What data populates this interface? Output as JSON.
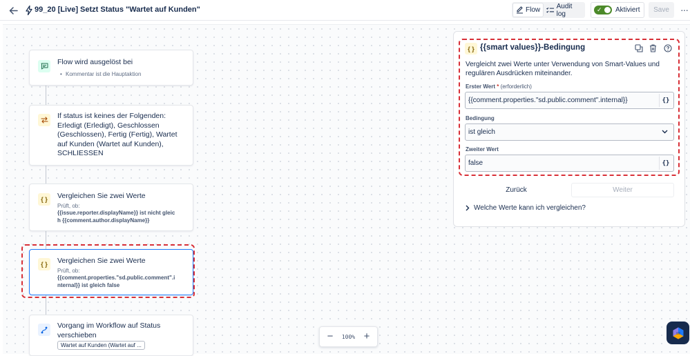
{
  "header": {
    "title": "99_20 [Live] Setzt Status \"Wartet auf Kunden\"",
    "flow_label": "Flow",
    "audit_label": "Audit log",
    "toggle_label": "Aktiviert",
    "toggle_on": true,
    "save_label": "Save",
    "more_label": "···"
  },
  "flow": {
    "trigger": {
      "title": "Flow wird ausgelöst bei",
      "detail": "Kommentar ist die Hauptaktion",
      "icon": "comment-icon"
    },
    "condition": {
      "title": "If status ist keines der Folgenden: Erledigt (Erledigt), Geschlossen (Geschlossen), Fertig (Fertig), Wartet auf Kunden (Wartet auf Kunden), SCHLIESSEN",
      "icon": "branch-arrows-icon"
    },
    "compare1": {
      "title": "Vergleichen Sie zwei Werte",
      "sub": "Prüft, ob:",
      "detail": "{{issue.reporter.displayName}} ist nicht gleich {{comment.author.displayName}}",
      "icon": "braces-icon"
    },
    "compare2": {
      "title": "Vergleichen Sie zwei Werte",
      "sub": "Prüft, ob:",
      "detail": "{{comment.properties.\"sd.public.comment\".internal}} ist gleich false",
      "icon": "braces-icon"
    },
    "transition": {
      "title": "Vorgang im Workflow auf Status verschieben",
      "chip": "Wartet auf Kunden (Wartet auf ...",
      "icon": "transition-icon"
    }
  },
  "zoom": {
    "minus": "−",
    "level": "100%",
    "plus": "+"
  },
  "panel": {
    "title": "{{smart values}}-Bedingung",
    "description": "Vergleicht zwei Werte unter Verwendung von Smart-Values und regulären Ausdrücken miteinander.",
    "first_label": "Erster Wert",
    "required_mark": "*",
    "required_hint": "(erforderlich)",
    "first_value": "{{comment.properties.\"sd.public.comment\".internal}}",
    "condition_label": "Bedingung",
    "condition_value": "ist gleich",
    "second_label": "Zweiter Wert",
    "second_value": "false",
    "braces_symbol": "{}",
    "back_label": "Zurück",
    "next_label": "Weiter",
    "help_label": "Welche Werte kann ich vergleichen?"
  },
  "colors": {
    "highlight_red": "#d82f37",
    "selected_blue": "#1d7afc",
    "toggle_green": "#4c8a2a"
  }
}
